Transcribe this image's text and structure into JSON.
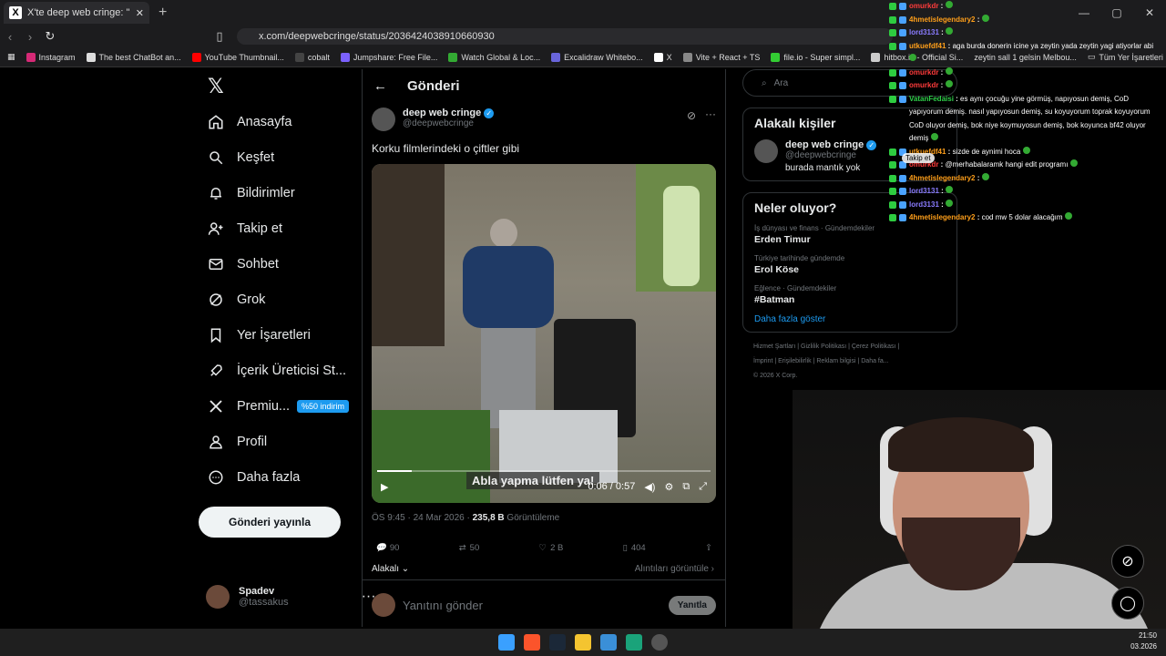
{
  "browser": {
    "tab_title": "X'te deep web cringe: \"Korku fil",
    "url": "x.com/deepwebcringe/status/2036424038910660930",
    "bookmarks": [
      "Instagram",
      "The best ChatBot an...",
      "YouTube Thumbnail...",
      "cobalt",
      "Jumpshare: Free File...",
      "Watch Global & Loc...",
      "Excalidraw Whitebo...",
      "X",
      "Vite + React + TS",
      "file.io - Super simpl...",
      "hitbox.io - Official Si...",
      "zeytin sall 1 gelsin Melbou..."
    ],
    "bookmarks_all": "Tüm Yer İşaretleri"
  },
  "sidebar": {
    "items": [
      {
        "label": "Anasayfa",
        "icon": "home-icon"
      },
      {
        "label": "Keşfet",
        "icon": "search-icon"
      },
      {
        "label": "Bildirimler",
        "icon": "bell-icon"
      },
      {
        "label": "Takip et",
        "icon": "follow-icon"
      },
      {
        "label": "Sohbet",
        "icon": "mail-icon"
      },
      {
        "label": "Grok",
        "icon": "grok-icon"
      },
      {
        "label": "Yer İşaretleri",
        "icon": "bookmark-icon"
      },
      {
        "label": "İçerik Üreticisi St...",
        "icon": "rocket-icon"
      },
      {
        "label": "Premiu...",
        "icon": "x-icon"
      },
      {
        "label": "Profil",
        "icon": "profile-icon"
      },
      {
        "label": "Daha fazla",
        "icon": "more-icon"
      }
    ],
    "premium_badge": "%50 indirim",
    "post_button": "Gönderi yayınla",
    "user_name": "Spadev",
    "user_handle": "@tassakus"
  },
  "post": {
    "header": "Gönderi",
    "author_name": "deep web cringe",
    "author_handle": "@deepwebcringe",
    "text": "Korku filmlerindeki o çiftler gibi",
    "video_caption": "Abla yapma lütfen ya!",
    "video_time": "0:06 / 0:57",
    "video_progress": 0.105,
    "time": "ÖS 9:45 · 24 Mar 2026 · ",
    "views_count": "235,8 B",
    "views_label": " Görüntüleme",
    "replies": "90",
    "reposts": "50",
    "likes": "2 B",
    "bookmarks": "404",
    "sort_label": "Alakalı",
    "quotes_label": "Alıntıları görüntüle",
    "reply_placeholder": "Yanıtını gönder",
    "reply_button": "Yanıtla"
  },
  "right": {
    "search_placeholder": "Ara",
    "related_title": "Alakalı kişiler",
    "related_name": "deep web cringe",
    "related_handle": "@deepwebcringe",
    "related_bio": "burada mantık yok",
    "follow_overlay": "Takip et",
    "trends_title": "Neler oluyor?",
    "trends": [
      {
        "category": "İş dünyası ve finans · Gündemdekiler",
        "title": "Erden Timur"
      },
      {
        "category": "Türkiye tarihinde gündemde",
        "title": "Erol Köse"
      },
      {
        "category": "Eğlence · Gündemdekiler",
        "title": "#Batman"
      }
    ],
    "show_more": "Daha fazla göster",
    "footer_line1": "Hizmet Şartları   |   Gizlilik Politikası   |   Çerez Politikası   |",
    "footer_line2": "İmprint   |   Erişilebilirlik   |   Reklam bilgisi   |   Daha fa...",
    "footer_line3": "© 2026 X Corp."
  },
  "chat": [
    {
      "user": "omurkdr",
      "color": "#ff3b3b",
      "msg": ""
    },
    {
      "user": "4hmetislegendary2",
      "color": "#ff9f1a",
      "msg": ""
    },
    {
      "user": "lord3131",
      "color": "#8a7cff",
      "msg": ""
    },
    {
      "user": "utkuefdf41",
      "color": "#ff9f1a",
      "msg": "aga burda donerin icine ya zeytin yada zeytin yagi atiyorlar abi"
    },
    {
      "user": "omurkdr",
      "color": "#ff3b3b",
      "msg": ""
    },
    {
      "user": "omurkdr",
      "color": "#ff3b3b",
      "msg": ""
    },
    {
      "user": "VatanFedaisi",
      "color": "#2fd04a",
      "msg": "es aynı çocuğu yine görmüş, napıyosun demiş, CoD yapıyorum demiş. nasıl yapıyosun demiş, su koyuyorum toprak koyuyorum CoD oluyor demiş, bok niye koymuyosun demiş, bok koyunca bf42 oluyor demiş"
    },
    {
      "user": "utkuefdf41",
      "color": "#ff9f1a",
      "msg": "sizde de aynimi hoca"
    },
    {
      "user": "omurkdr",
      "color": "#ff3b3b",
      "msg": "@merhabalaramk hangi edit programı"
    },
    {
      "user": "4hmetislegendary2",
      "color": "#ff9f1a",
      "msg": ""
    },
    {
      "user": "lord3131",
      "color": "#8a7cff",
      "msg": ""
    },
    {
      "user": "lord3131",
      "color": "#8a7cff",
      "msg": ""
    },
    {
      "user": "4hmetislegendary2",
      "color": "#ff9f1a",
      "msg": "cod mw 5 dolar alacağım"
    }
  ],
  "clock": {
    "time": "21:50",
    "date": "03.2026"
  },
  "colors": {
    "accent": "#1d9bf0",
    "bg": "#000000",
    "border": "#2f3336"
  }
}
